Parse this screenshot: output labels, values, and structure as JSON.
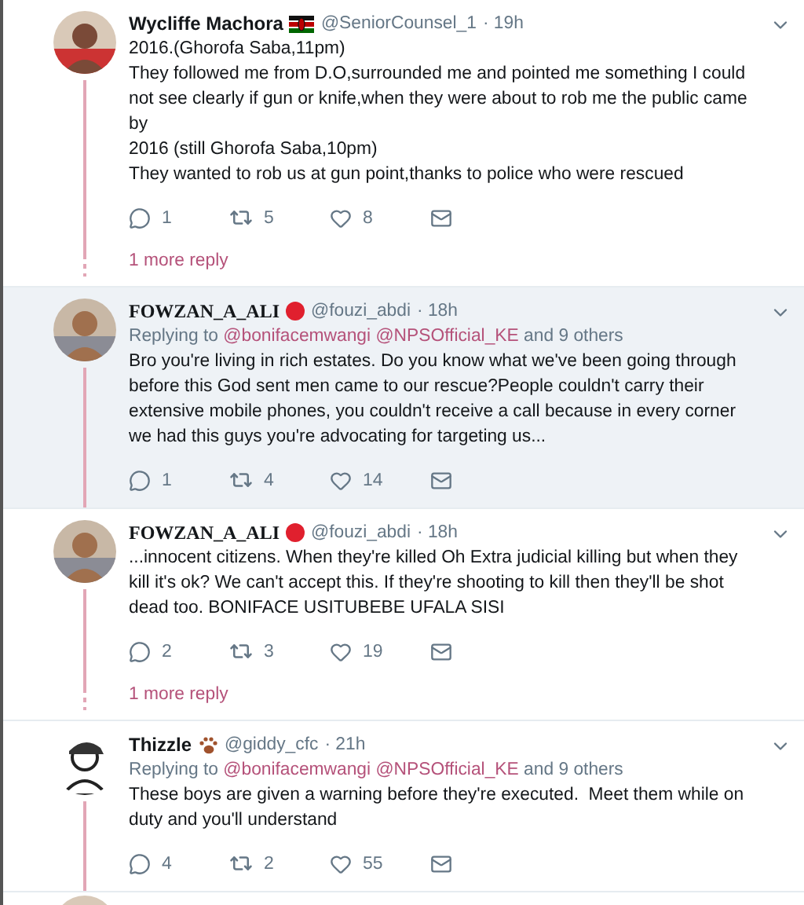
{
  "tweets": [
    {
      "name": "Wycliffe Machora",
      "badge": {
        "kind": "flag"
      },
      "handle": "@SeniorCounsel_1",
      "time": "· 19h",
      "highlighted": false,
      "paragraphs": [
        "2016.(Ghorofa Saba,11pm)",
        "They followed me from D.O,surrounded me and pointed me something I could not see clearly if gun or knife,when they were about to rob me the public came by",
        "2016 (still Ghorofa Saba,10pm)",
        "They wanted to rob us at gun point,thanks to police who were rescued"
      ],
      "replies": "1",
      "retweets": "5",
      "likes": "8",
      "more": "1 more reply"
    },
    {
      "name": "FOWZAN_A_ALI",
      "badge": {
        "kind": "dot"
      },
      "handle": "@fouzi_abdi",
      "time": "· 18h",
      "highlighted": true,
      "replying": {
        "label": "Replying to",
        "mentions": [
          "@bonifacemwangi",
          "@NPSOfficial_KE"
        ],
        "others": "and 9 others"
      },
      "paragraphs": [
        "Bro you're living in rich estates. Do you know what we've been going through before this God sent men came to our rescue?People couldn't carry their extensive mobile phones, you couldn't receive a call because in every corner we had this guys you're advocating for targeting us..."
      ],
      "replies": "1",
      "retweets": "4",
      "likes": "14"
    },
    {
      "name": "FOWZAN_A_ALI",
      "badge": {
        "kind": "dot"
      },
      "handle": "@fouzi_abdi",
      "time": "· 18h",
      "highlighted": false,
      "paragraphs": [
        "...innocent citizens. When they're killed Oh Extra judicial killing but when they kill it's ok? We can't accept this. If they're shooting to kill then they'll be shot dead too. BONIFACE USITUBEBE UFALA SISI"
      ],
      "replies": "2",
      "retweets": "3",
      "likes": "19",
      "more": "1 more reply"
    },
    {
      "name": "Thizzle",
      "badge": {
        "kind": "paw"
      },
      "handle": "@giddy_cfc",
      "time": "· 21h",
      "highlighted": false,
      "replying": {
        "label": "Replying to",
        "mentions": [
          "@bonifacemwangi",
          "@NPSOfficial_KE"
        ],
        "others": "and 9 others"
      },
      "paragraphs": [
        "These boys are given a warning before they're executed.  Meet them while on duty and you'll understand"
      ],
      "replies": "4",
      "retweets": "2",
      "likes": "55"
    }
  ]
}
